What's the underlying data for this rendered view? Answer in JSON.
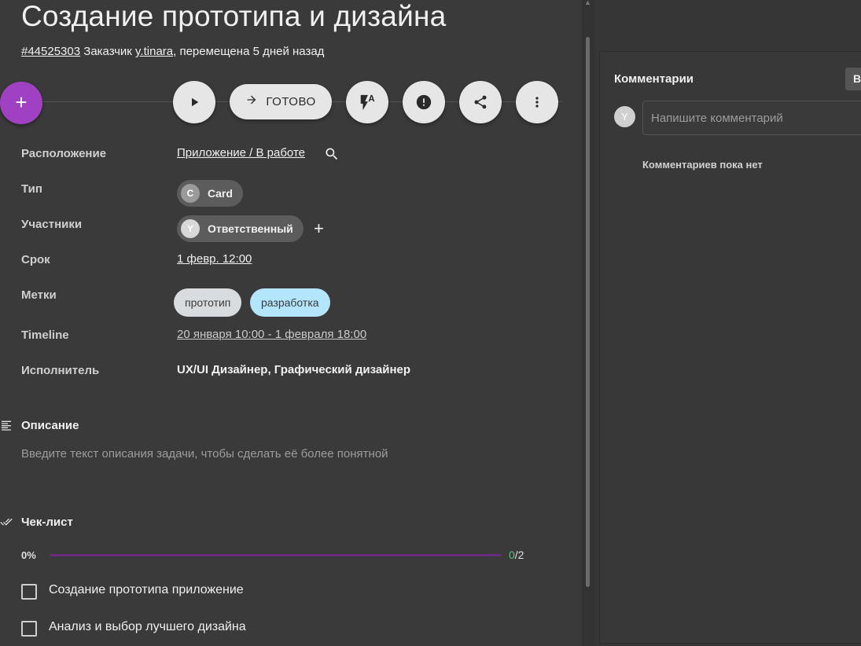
{
  "task": {
    "title": "Создание прототипа и дизайна",
    "id": "#44525303",
    "subtitle_prefix": " Заказчик ",
    "customer": "y.tinara",
    "subtitle_suffix": ", перемещена 5 дней назад"
  },
  "toolbar": {
    "add_label": "+",
    "done_label": "ГОТОВО"
  },
  "fields": {
    "location": {
      "label": "Расположение",
      "value": "Приложение / В работе"
    },
    "type": {
      "label": "Тип",
      "chip_initial": "C",
      "chip_label": "Card"
    },
    "members": {
      "label": "Участники",
      "chip_initial": "Y",
      "chip_label": "Ответственный",
      "add_label": "+"
    },
    "deadline": {
      "label": "Срок",
      "value": "1 февр. 12:00"
    },
    "tags": {
      "label": "Метки",
      "items": [
        {
          "label": "прототип",
          "color": "#d9dcdf"
        },
        {
          "label": "разработка",
          "color": "#b3e5fc"
        }
      ]
    },
    "timeline": {
      "label": "Timeline",
      "value": "20 января 10:00 - 1 февраля 18:00"
    },
    "assignee": {
      "label": "Исполнитель",
      "value": "UX/UI Дизайнер, Графический дизайнер"
    }
  },
  "description": {
    "title": "Описание",
    "placeholder": "Введите текст описания задачи, чтобы сделать её более понятной"
  },
  "checklist": {
    "title": "Чек-лист",
    "percent_label": "0%",
    "progress": 0,
    "done": "0",
    "total_label": "/2",
    "items": [
      {
        "label": "Создание прототипа приложение",
        "checked": false
      },
      {
        "label": "Анализ и выбор лучшего дизайна",
        "checked": false
      }
    ]
  },
  "comments": {
    "title": "Комментарии",
    "button_label": "В",
    "avatar_initial": "Y",
    "input_placeholder": "Напишите комментарий",
    "empty_text": "Комментариев пока нет"
  },
  "colors": {
    "accent": "#a041c4",
    "background": "#3a3a3a",
    "progress_track": "#6a2b7a",
    "tag_prototype": "#d9dcdf",
    "tag_development": "#b3e5fc"
  },
  "icons": [
    "plus-icon",
    "play-icon",
    "arrow-right-icon",
    "flash-auto-icon",
    "alert-icon",
    "share-icon",
    "more-vert-icon",
    "search-icon",
    "notes-icon",
    "done-all-icon"
  ]
}
